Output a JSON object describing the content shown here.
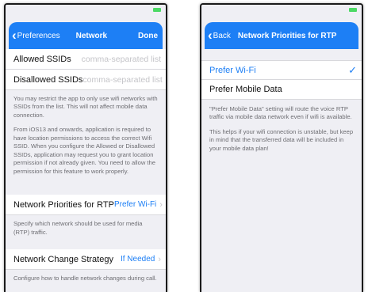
{
  "left": {
    "nav": {
      "back_label": "Preferences",
      "title": "Network",
      "done_label": "Done"
    },
    "allowed_ssids": {
      "label": "Allowed SSIDs",
      "placeholder": "comma-separated list"
    },
    "disallowed_ssids": {
      "label": "Disallowed SSIDs",
      "placeholder": "comma-separated list"
    },
    "ssid_help_1": "You may restrict the app to only use wifi networks with SSIDs from the list. This will not affect mobile data connection.",
    "ssid_help_2": "From iOS13 and onwards, application is required to have location permissions to access the correct Wifi SSID. When you configure the Allowed or Disallowed SSIDs, application may request you to grant location permission if not already given. You need to allow the permission for this feature to work properly.",
    "rtp_priority": {
      "label": "Network Priorities for RTP",
      "value": "Prefer Wi-Fi",
      "help": "Specify which network should be used for media (RTP) traffic."
    },
    "change_strategy": {
      "label": "Network Change Strategy",
      "value": "If Needed",
      "help": "Configure how to handle network changes during call."
    }
  },
  "right": {
    "nav": {
      "back_label": "Back",
      "title": "Network Priorities for RTP"
    },
    "options": [
      {
        "label": "Prefer Wi-Fi",
        "selected": true
      },
      {
        "label": "Prefer Mobile Data",
        "selected": false
      }
    ],
    "help_1": "\"Prefer Mobile Data\" setting will route the voice RTP traffic via mobile data network even if wifi is available.",
    "help_2": "This helps if your wifi connection is unstable, but keep in mind that the transferred data will be included in your mobile data plan!"
  },
  "colors": {
    "accent": "#1d7ff5",
    "background": "#efeff4",
    "battery": "#4cd964"
  }
}
